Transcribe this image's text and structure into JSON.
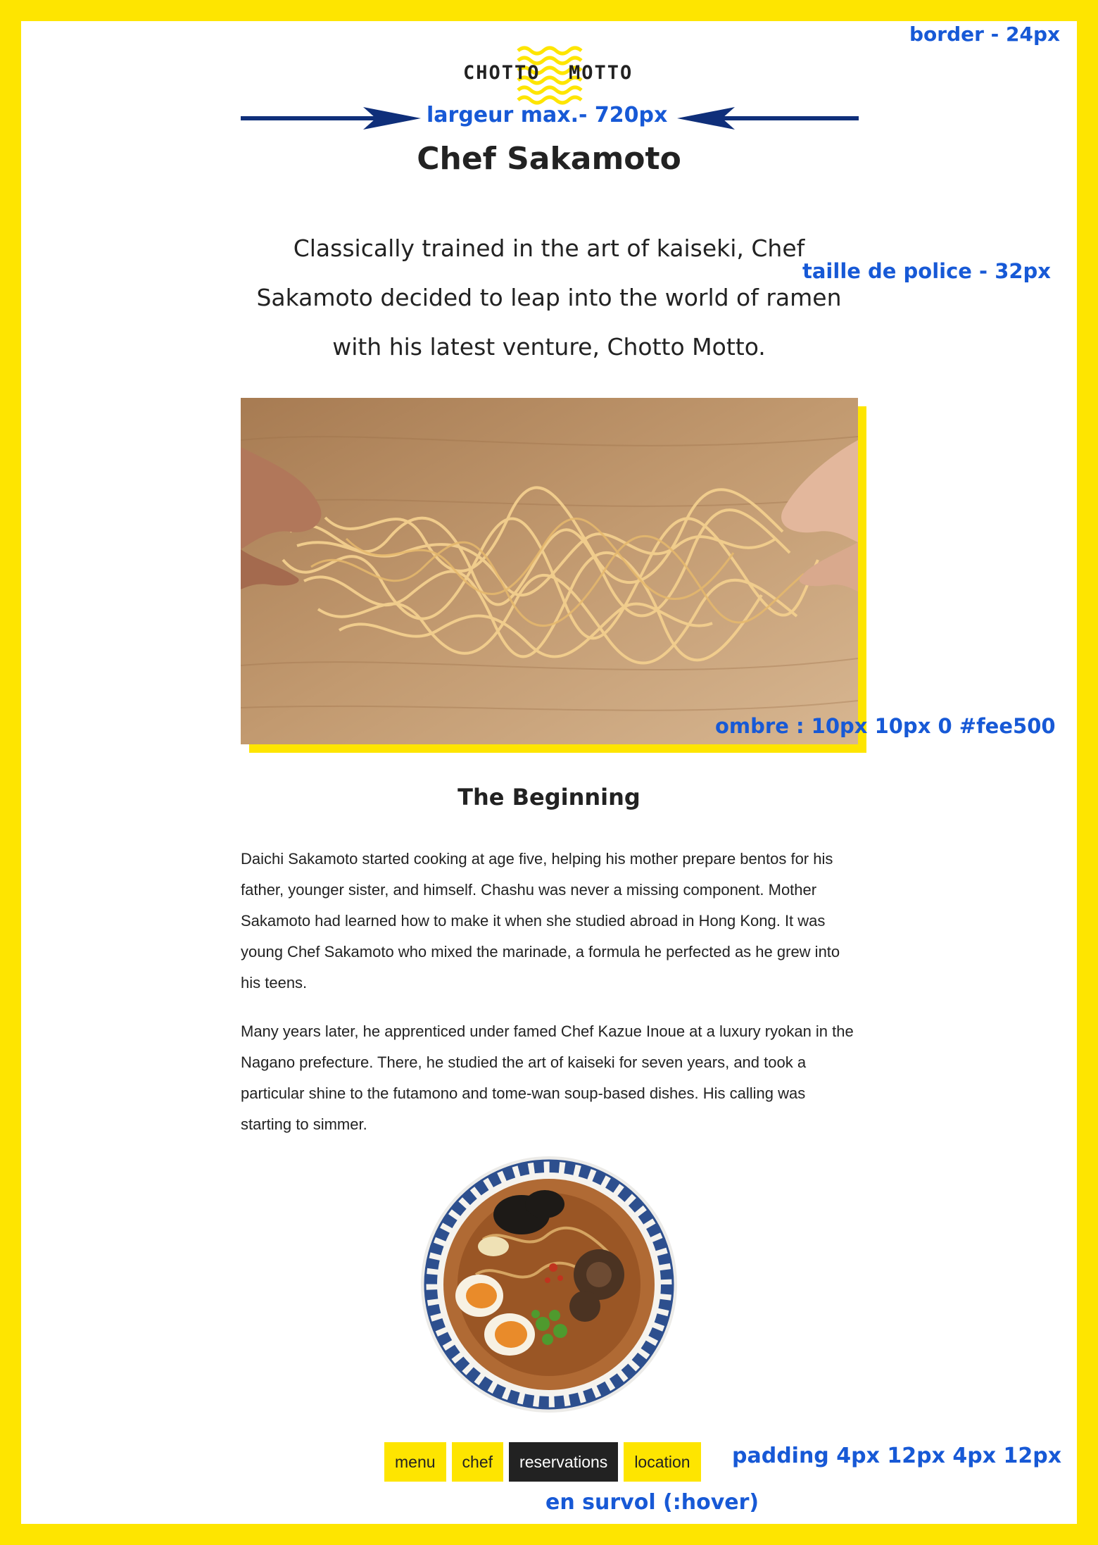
{
  "colors": {
    "accent": "#fee500",
    "annotation": "#1759d6",
    "text": "#222222",
    "hover_bg": "#222222"
  },
  "logo": {
    "word_left": "CHOTTO",
    "word_right": "MOTTO"
  },
  "annotations": {
    "border": "border - 24px",
    "max_width": "largeur max.- 720px",
    "font_size": "taille de police - 32px",
    "shadow": "ombre : 10px 10px 0 #fee500",
    "padding": "padding 4px 12px 4px 12px",
    "hover": "en survol (:hover)"
  },
  "page": {
    "title": "Chef Sakamoto",
    "lead": "Classically trained in the art of kaiseki, Chef Sakamoto decided to leap into the world of ramen with his latest venture, Chotto Motto.",
    "section_title": "The Beginning",
    "paragraphs": [
      "Daichi Sakamoto started cooking at age five, helping his mother prepare bentos for his father, younger sister, and himself. Chashu was never a missing component. Mother Sakamoto had learned how to make it when she studied abroad in Hong Kong. It was young Chef Sakamoto who mixed the marinade, a formula he perfected as he grew into his teens.",
      "Many years later, he apprenticed under famed Chef Kazue Inoue at a luxury ryokan in the Nagano prefecture. There, he studied the art of kaiseki for seven years, and took a particular shine to the futamono and tome-wan soup-based dishes. His calling was starting to simmer."
    ]
  },
  "nav": {
    "items": [
      {
        "label": "menu",
        "state": "default"
      },
      {
        "label": "chef",
        "state": "default"
      },
      {
        "label": "reservations",
        "state": "hover"
      },
      {
        "label": "location",
        "state": "default"
      }
    ]
  },
  "icons": [
    "noodle-wave-logo-icon",
    "arrow-right-icon",
    "arrow-left-icon"
  ]
}
